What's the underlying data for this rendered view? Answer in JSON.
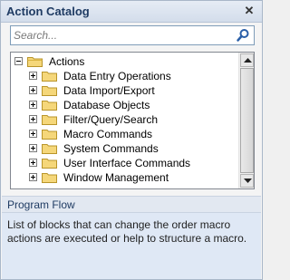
{
  "panel": {
    "title": "Action Catalog"
  },
  "search": {
    "placeholder": "Search...",
    "icon": "search-icon"
  },
  "tree": {
    "root": {
      "label": "Actions",
      "expanded": true
    },
    "children": [
      {
        "label": "Data Entry Operations"
      },
      {
        "label": "Data Import/Export"
      },
      {
        "label": "Database Objects"
      },
      {
        "label": "Filter/Query/Search"
      },
      {
        "label": "Macro Commands"
      },
      {
        "label": "System Commands"
      },
      {
        "label": "User Interface Commands"
      },
      {
        "label": "Window Management"
      }
    ]
  },
  "description": {
    "heading": "Program Flow",
    "text": "List of blocks that can change the order macro actions are executed or help to structure a macro."
  },
  "colors": {
    "folder": "#e8c24a",
    "accent": "#1f3b63"
  }
}
